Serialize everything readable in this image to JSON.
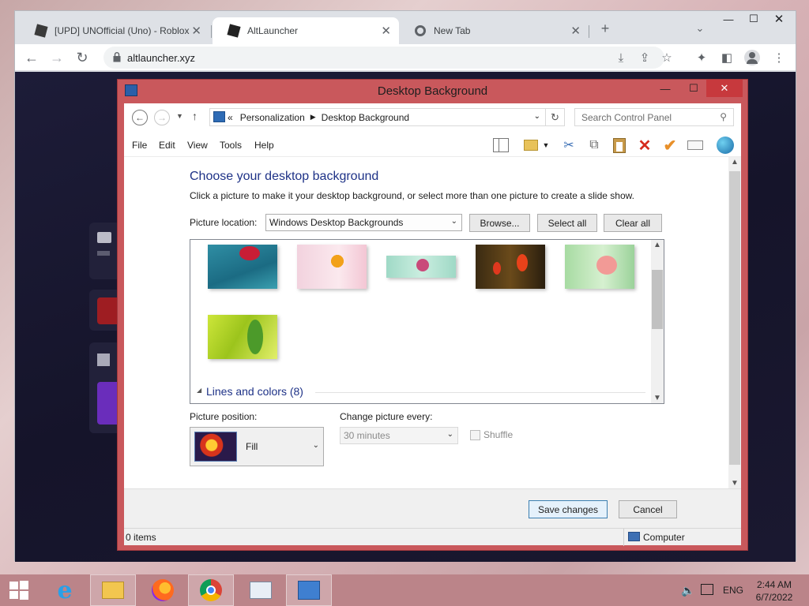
{
  "browser": {
    "tabs": [
      {
        "title": "[UPD] UNOfficial (Uno) - Roblox",
        "active": false
      },
      {
        "title": "AltLauncher",
        "active": true
      },
      {
        "title": "New Tab",
        "active": false
      }
    ],
    "url": "altlauncher.xyz"
  },
  "dialog": {
    "title": "Desktop Background",
    "breadcrumb": {
      "overflow": "«",
      "parent": "Personalization",
      "current": "Desktop Background"
    },
    "search_placeholder": "Search Control Panel",
    "menu": [
      "File",
      "Edit",
      "View",
      "Tools",
      "Help"
    ],
    "heading": "Choose your desktop background",
    "subtext": "Click a picture to make it your desktop background, or select more than one picture to create a slide show.",
    "picture_location_label": "Picture location:",
    "picture_location_value": "Windows Desktop Backgrounds",
    "buttons": {
      "browse": "Browse...",
      "select_all": "Select all",
      "clear_all": "Clear all",
      "save": "Save changes",
      "cancel": "Cancel"
    },
    "group_title": "Lines and colors (8)",
    "picture_position_label": "Picture position:",
    "picture_position_value": "Fill",
    "change_every_label": "Change picture every:",
    "change_every_value": "30 minutes",
    "shuffle_label": "Shuffle",
    "status_items": "0 items",
    "status_location": "Computer"
  },
  "taskbar": {
    "language": "ENG",
    "time": "2:44 AM",
    "date": "6/7/2022"
  }
}
